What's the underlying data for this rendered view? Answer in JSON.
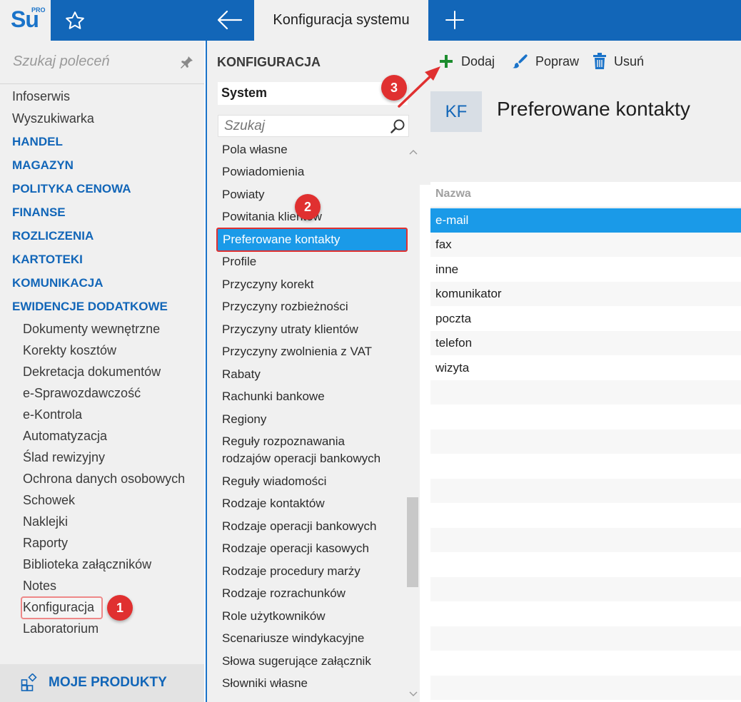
{
  "topbar": {
    "logo_text": "Su",
    "logo_sup": "PRO",
    "active_tab": "Konfiguracja systemu"
  },
  "sidebar": {
    "search_placeholder": "Szukaj poleceń",
    "top_items": [
      "Infoserwis",
      "Wyszukiwarka"
    ],
    "categories": [
      "HANDEL",
      "MAGAZYN",
      "POLITYKA CENOWA",
      "FINANSE",
      "ROZLICZENIA",
      "KARTOTEKI",
      "KOMUNIKACJA",
      "EWIDENCJE DODATKOWE"
    ],
    "sub_items": [
      "Dokumenty wewnętrzne",
      "Korekty kosztów",
      "Dekretacja dokumentów",
      "e-Sprawozdawczość",
      "e-Kontrola",
      "Automatyzacja",
      "Ślad rewizyjny",
      "Ochrona danych osobowych",
      "Schowek",
      "Naklejki",
      "Raporty",
      "Biblioteka załączników",
      "Notes",
      "Konfiguracja",
      "Laboratorium"
    ],
    "bottom_label": "MOJE PRODUKTY"
  },
  "middle": {
    "title": "KONFIGURACJA",
    "select_value": "System",
    "search_placeholder": "Szukaj",
    "items": [
      "Pola własne",
      "Powiadomienia",
      "Powiaty",
      "Powitania klientów",
      "Preferowane kontakty",
      "Profile",
      "Przyczyny korekt",
      "Przyczyny rozbieżności",
      "Przyczyny utraty klientów",
      "Przyczyny zwolnienia z VAT",
      "Rabaty",
      "Rachunki bankowe",
      "Regiony",
      "Reguły rozpoznawania",
      "rodzajów operacji bankowych",
      "Reguły wiadomości",
      "Rodzaje kontaktów",
      "Rodzaje operacji bankowych",
      "Rodzaje operacji kasowych",
      "Rodzaje procedury marży",
      "Rodzaje rozrachunków",
      "Role użytkowników",
      "Scenariusze windykacyjne",
      "Słowa sugerujące załącznik",
      "Słowniki własne"
    ],
    "selected_index": 4
  },
  "right": {
    "toolbar": {
      "add": "Dodaj",
      "edit": "Popraw",
      "delete": "Usuń"
    },
    "badge": "KF",
    "title": "Preferowane kontakty",
    "column": "Nazwa",
    "rows": [
      "e-mail",
      "fax",
      "inne",
      "komunikator",
      "poczta",
      "telefon",
      "wizyta"
    ]
  },
  "annotations": [
    "1",
    "2",
    "3"
  ],
  "colors": {
    "brand": "#1266b8",
    "selection": "#1a9ae8",
    "annotation": "#e03030",
    "add_icon": "#1c8c2e"
  }
}
